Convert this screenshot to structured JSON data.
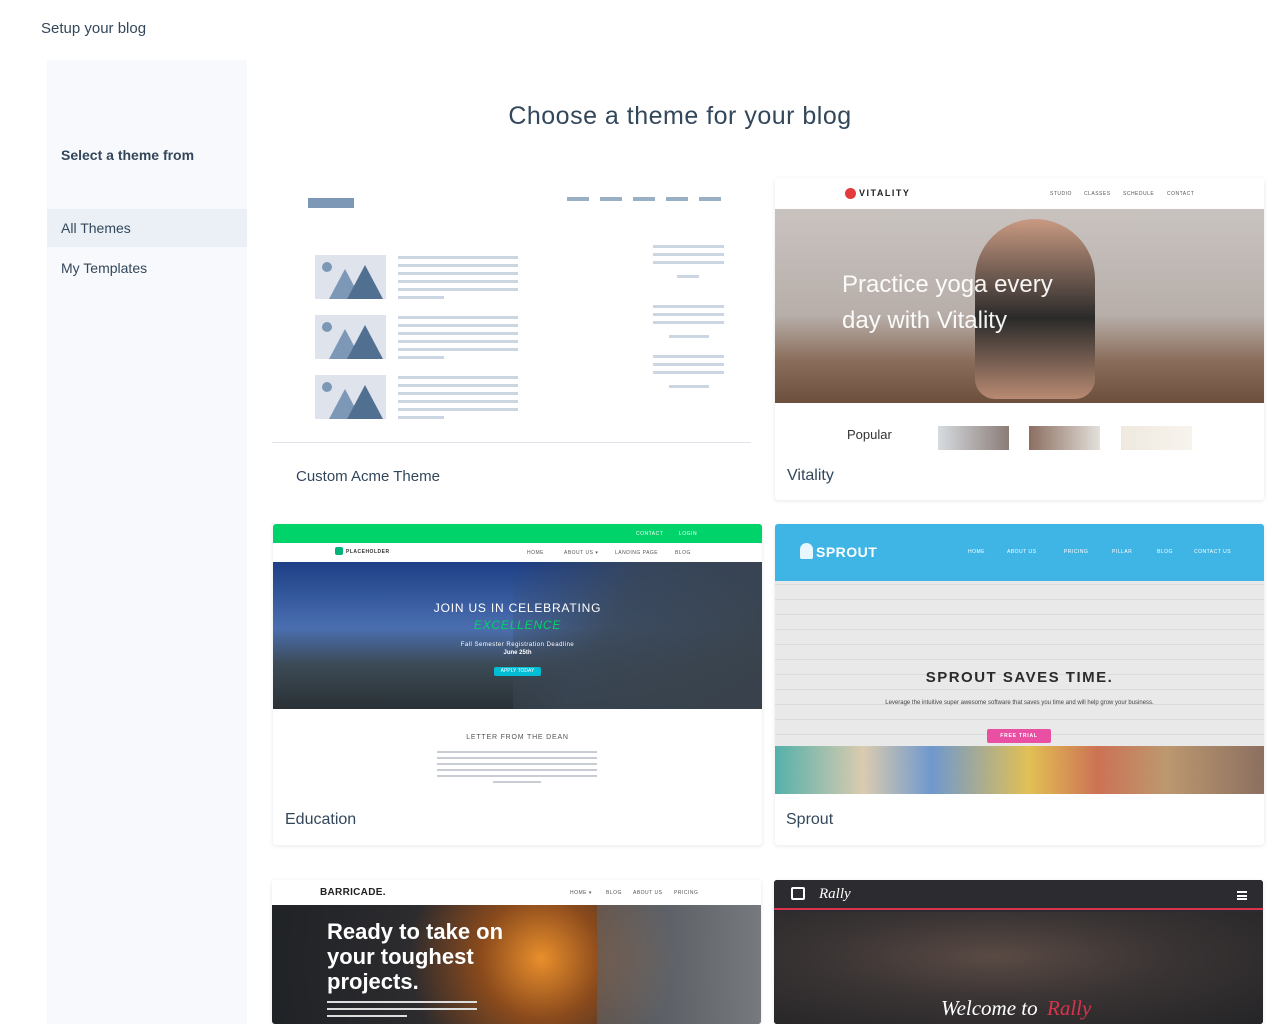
{
  "header": {
    "breadcrumb": "Setup your blog"
  },
  "main": {
    "title": "Choose a theme for your blog"
  },
  "sidebar": {
    "heading": "Select a theme from",
    "items": [
      {
        "label": "All Themes",
        "active": true
      },
      {
        "label": "My Templates",
        "active": false
      }
    ]
  },
  "themes": [
    {
      "name": "Custom Acme Theme"
    },
    {
      "name": "Vitality",
      "preview": {
        "logo": "VITALITY",
        "nav": [
          "STUDIO",
          "CLASSES",
          "SCHEDULE",
          "CONTACT"
        ],
        "hero_line1": "Practice yoga every",
        "hero_line2": "day with Vitality",
        "section": "Popular"
      }
    },
    {
      "name": "Education",
      "preview": {
        "topbar": [
          "CONTACT",
          "LOGIN"
        ],
        "logo": "PLACEHOLDER",
        "nav": [
          "HOME",
          "ABOUT US ▾",
          "LANDING PAGE",
          "BLOG"
        ],
        "hero_line1": "JOIN US IN CELEBRATING",
        "hero_line2": "EXCELLENCE",
        "hero_line3": "Fall Semester Registration Deadline",
        "hero_line4": "June 25th",
        "cta": "APPLY TODAY",
        "section": "LETTER FROM THE DEAN"
      }
    },
    {
      "name": "Sprout",
      "preview": {
        "logo": "SPROUT",
        "nav": [
          "HOME",
          "ABOUT US",
          "PRICING",
          "PILLAR",
          "BLOG",
          "CONTACT US"
        ],
        "headline": "SPROUT SAVES TIME.",
        "subline": "Leverage the intuitive super awesome software that saves you time and will help grow your business.",
        "cta": "FREE TRIAL"
      }
    },
    {
      "name": "Barricade",
      "preview": {
        "logo": "BARRICADE.",
        "nav": [
          "HOME ▾",
          "BLOG",
          "ABOUT US",
          "PRICING"
        ],
        "headline_1": "Ready to take on",
        "headline_2": "your toughest",
        "headline_3": "projects."
      }
    },
    {
      "name": "Rally",
      "preview": {
        "logo": "Rally",
        "headline_a": "Welcome to",
        "headline_b": "Rally"
      }
    }
  ],
  "colors": {
    "accent": "#33475b",
    "education_green": "#00d36a",
    "sprout_blue": "#3fb5e6",
    "sprout_pink": "#e950a3",
    "rally_dark": "#2b2b30",
    "rally_red": "#d9334e"
  }
}
